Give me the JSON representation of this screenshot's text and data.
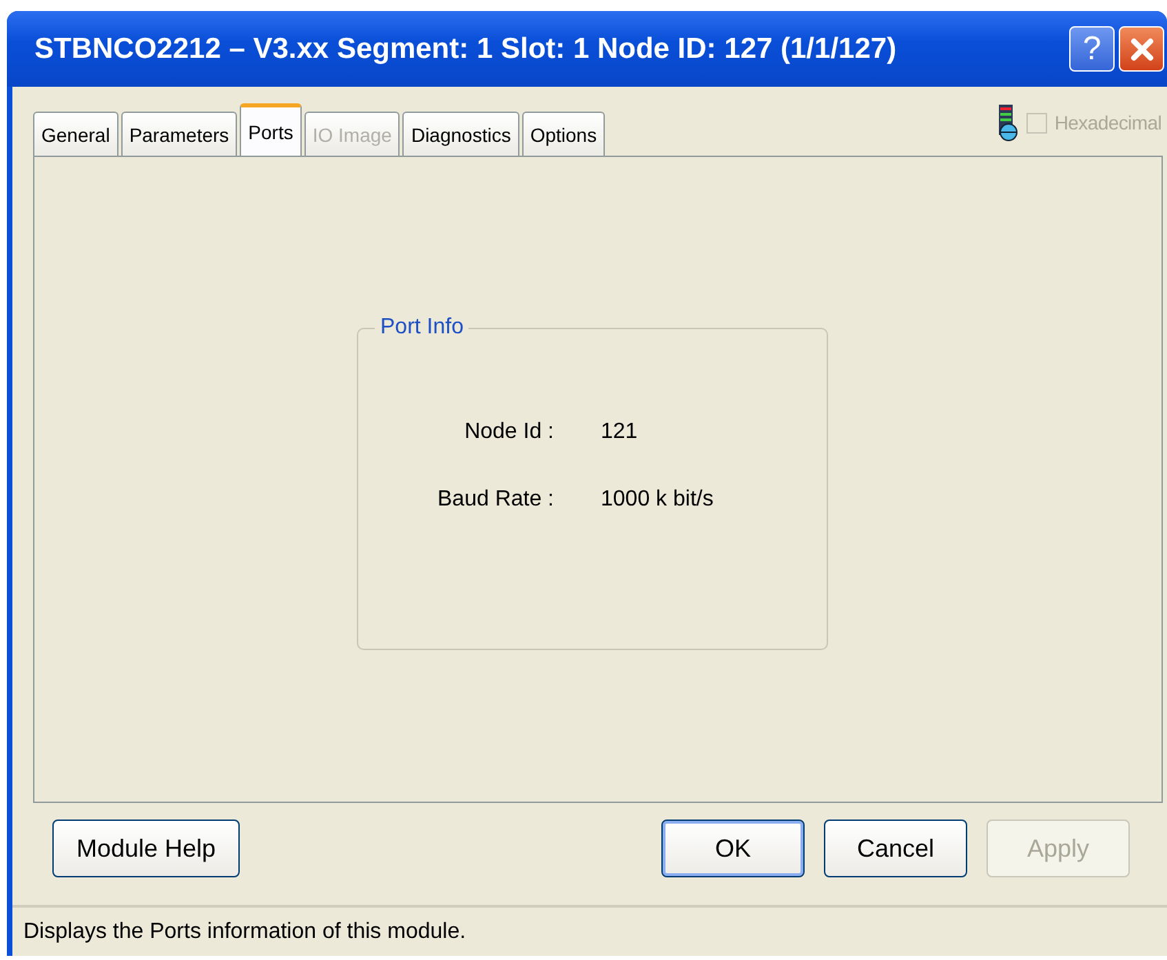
{
  "window": {
    "title": "STBNCO2212 – V3.xx Segment: 1 Slot: 1 Node ID: 127 (1/1/127)"
  },
  "title_buttons": [
    {
      "kind": "help",
      "label": "?"
    },
    {
      "kind": "close"
    }
  ],
  "tabs": [
    {
      "label": "General",
      "selected": false,
      "disabled": false
    },
    {
      "label": "Parameters",
      "selected": false,
      "disabled": false
    },
    {
      "label": "Ports",
      "selected": true,
      "disabled": false
    },
    {
      "label": "IO Image",
      "selected": false,
      "disabled": true
    },
    {
      "label": "Diagnostics",
      "selected": false,
      "disabled": false
    },
    {
      "label": "Options",
      "selected": false,
      "disabled": false
    }
  ],
  "hexadecimal": {
    "label": "Hexadecimal",
    "checked": false,
    "disabled": true
  },
  "port_info": {
    "title": "Port Info",
    "fields": [
      {
        "label": "Node Id :",
        "value": "121"
      },
      {
        "label": "Baud Rate :",
        "value": "1000 k bit/s"
      }
    ]
  },
  "help_button": {
    "label": "Module Help"
  },
  "buttons": [
    {
      "label": "OK",
      "default": true,
      "disabled": false
    },
    {
      "label": "Cancel",
      "default": false,
      "disabled": false
    },
    {
      "label": "Apply",
      "default": false,
      "disabled": true
    }
  ],
  "status_bar": "Displays the Ports information of this module."
}
